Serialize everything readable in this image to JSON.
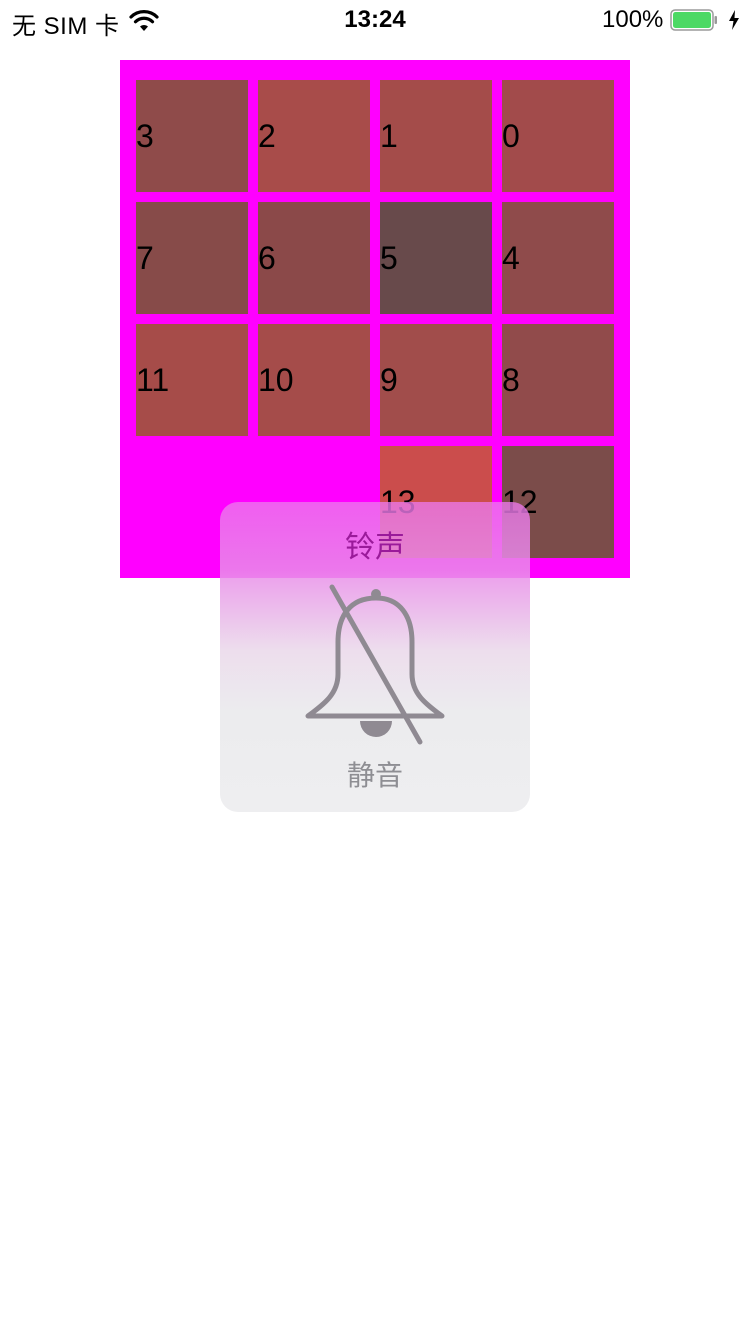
{
  "status_bar": {
    "carrier": "无 SIM 卡",
    "time": "13:24",
    "battery_percent": "100%",
    "battery_level": 1.0,
    "icons": [
      "wifi-icon",
      "battery-icon",
      "charging-bolt-icon"
    ]
  },
  "board": {
    "background": "#ff00ff",
    "tiles": [
      {
        "label": "3",
        "color": "#8f4b4a"
      },
      {
        "label": "2",
        "color": "#a84c4a"
      },
      {
        "label": "1",
        "color": "#a44c4a"
      },
      {
        "label": "0",
        "color": "#a24b4b"
      },
      {
        "label": "7",
        "color": "#874b49"
      },
      {
        "label": "6",
        "color": "#8b4949"
      },
      {
        "label": "5",
        "color": "#684a4b"
      },
      {
        "label": "4",
        "color": "#8f4b4b"
      },
      {
        "label": "11",
        "color": "#a64c49"
      },
      {
        "label": "10",
        "color": "#a54c4a"
      },
      {
        "label": "9",
        "color": "#a14d4b"
      },
      {
        "label": "8",
        "color": "#914b4b"
      },
      {
        "label": "13",
        "color": "#cb4d4c"
      },
      {
        "label": "12",
        "color": "#7b4c4a"
      }
    ]
  },
  "hud": {
    "title": "铃声",
    "caption": "静音",
    "icon": "bell-slash-icon"
  }
}
